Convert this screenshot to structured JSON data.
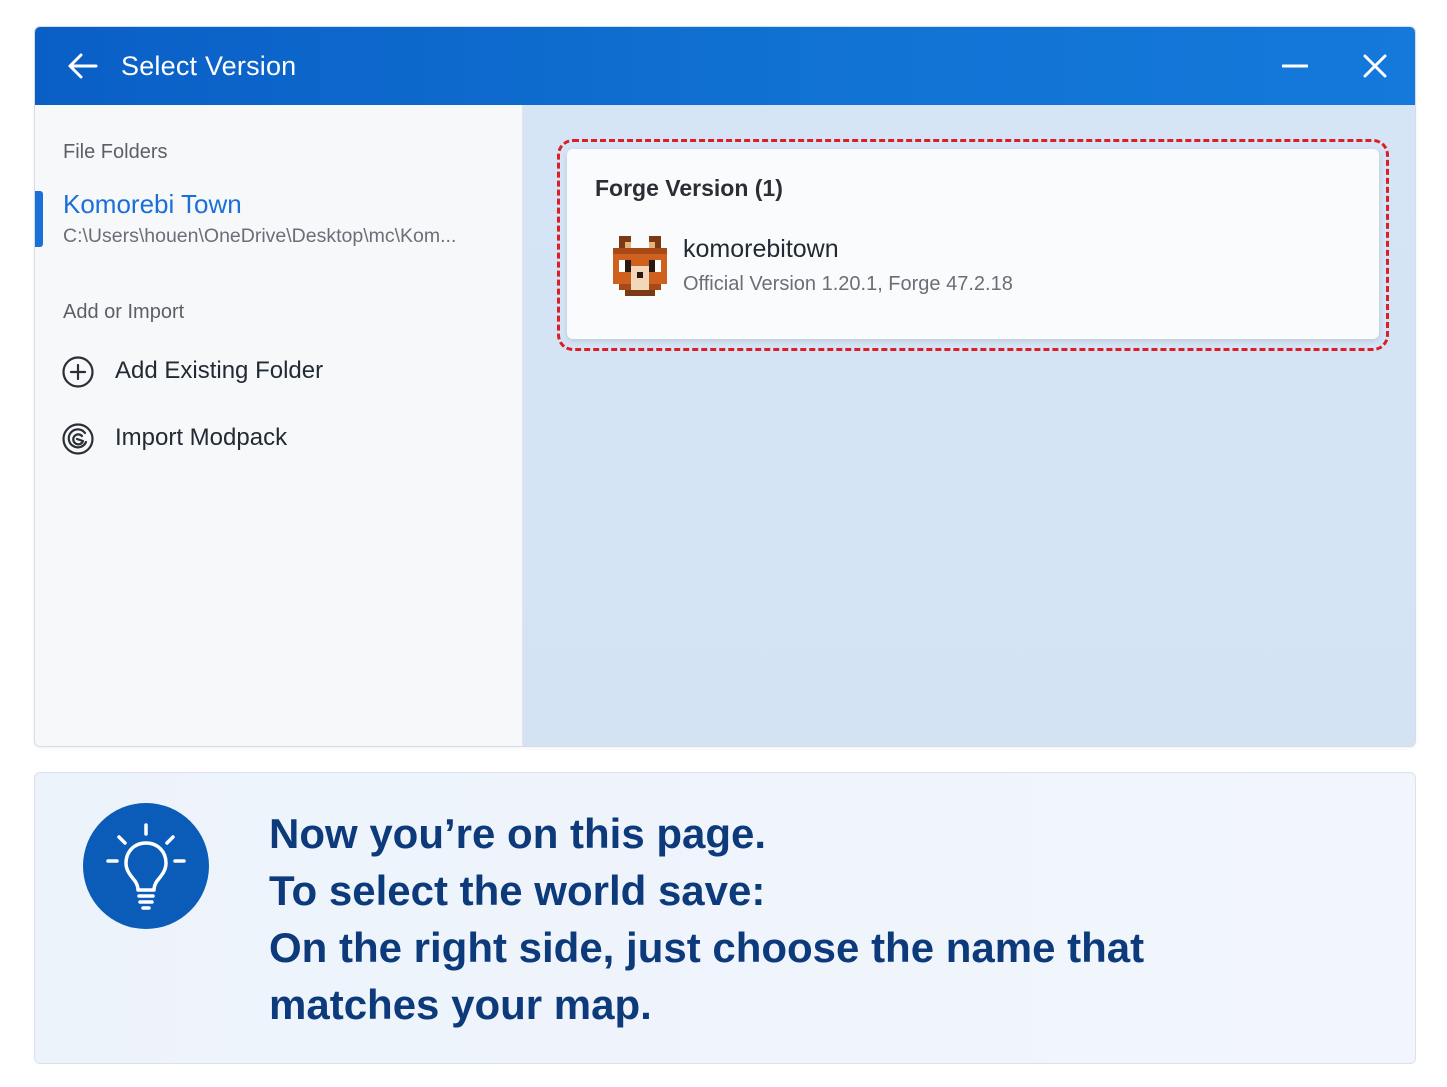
{
  "window": {
    "title": "Select Version"
  },
  "sidebar": {
    "folders_label": "File Folders",
    "folders": [
      {
        "name": "Komorebi Town",
        "path": "C:\\Users\\houen\\OneDrive\\Desktop\\mc\\Kom..."
      }
    ],
    "add_label": "Add or Import",
    "actions": [
      {
        "label": "Add Existing Folder",
        "icon": "plus-circle-icon"
      },
      {
        "label": "Import Modpack",
        "icon": "import-modpack-icon"
      }
    ]
  },
  "content": {
    "group_title": "Forge Version (1)",
    "versions": [
      {
        "name": "komorebitown",
        "desc": "Official Version 1.20.1, Forge 47.2.18",
        "icon": "fox-avatar-icon"
      }
    ]
  },
  "tip": {
    "icon": "lightbulb-icon",
    "lines": [
      "Now you’re on this page.",
      "To select the world save:",
      "On the right side, just choose the name that",
      "matches your map."
    ]
  },
  "colors": {
    "titlebar": "#0a5fc6",
    "accent": "#1a6fd8",
    "highlight": "#dc1f26",
    "tip_text": "#0d3a7a",
    "tip_icon_bg": "#0b5cb8"
  }
}
